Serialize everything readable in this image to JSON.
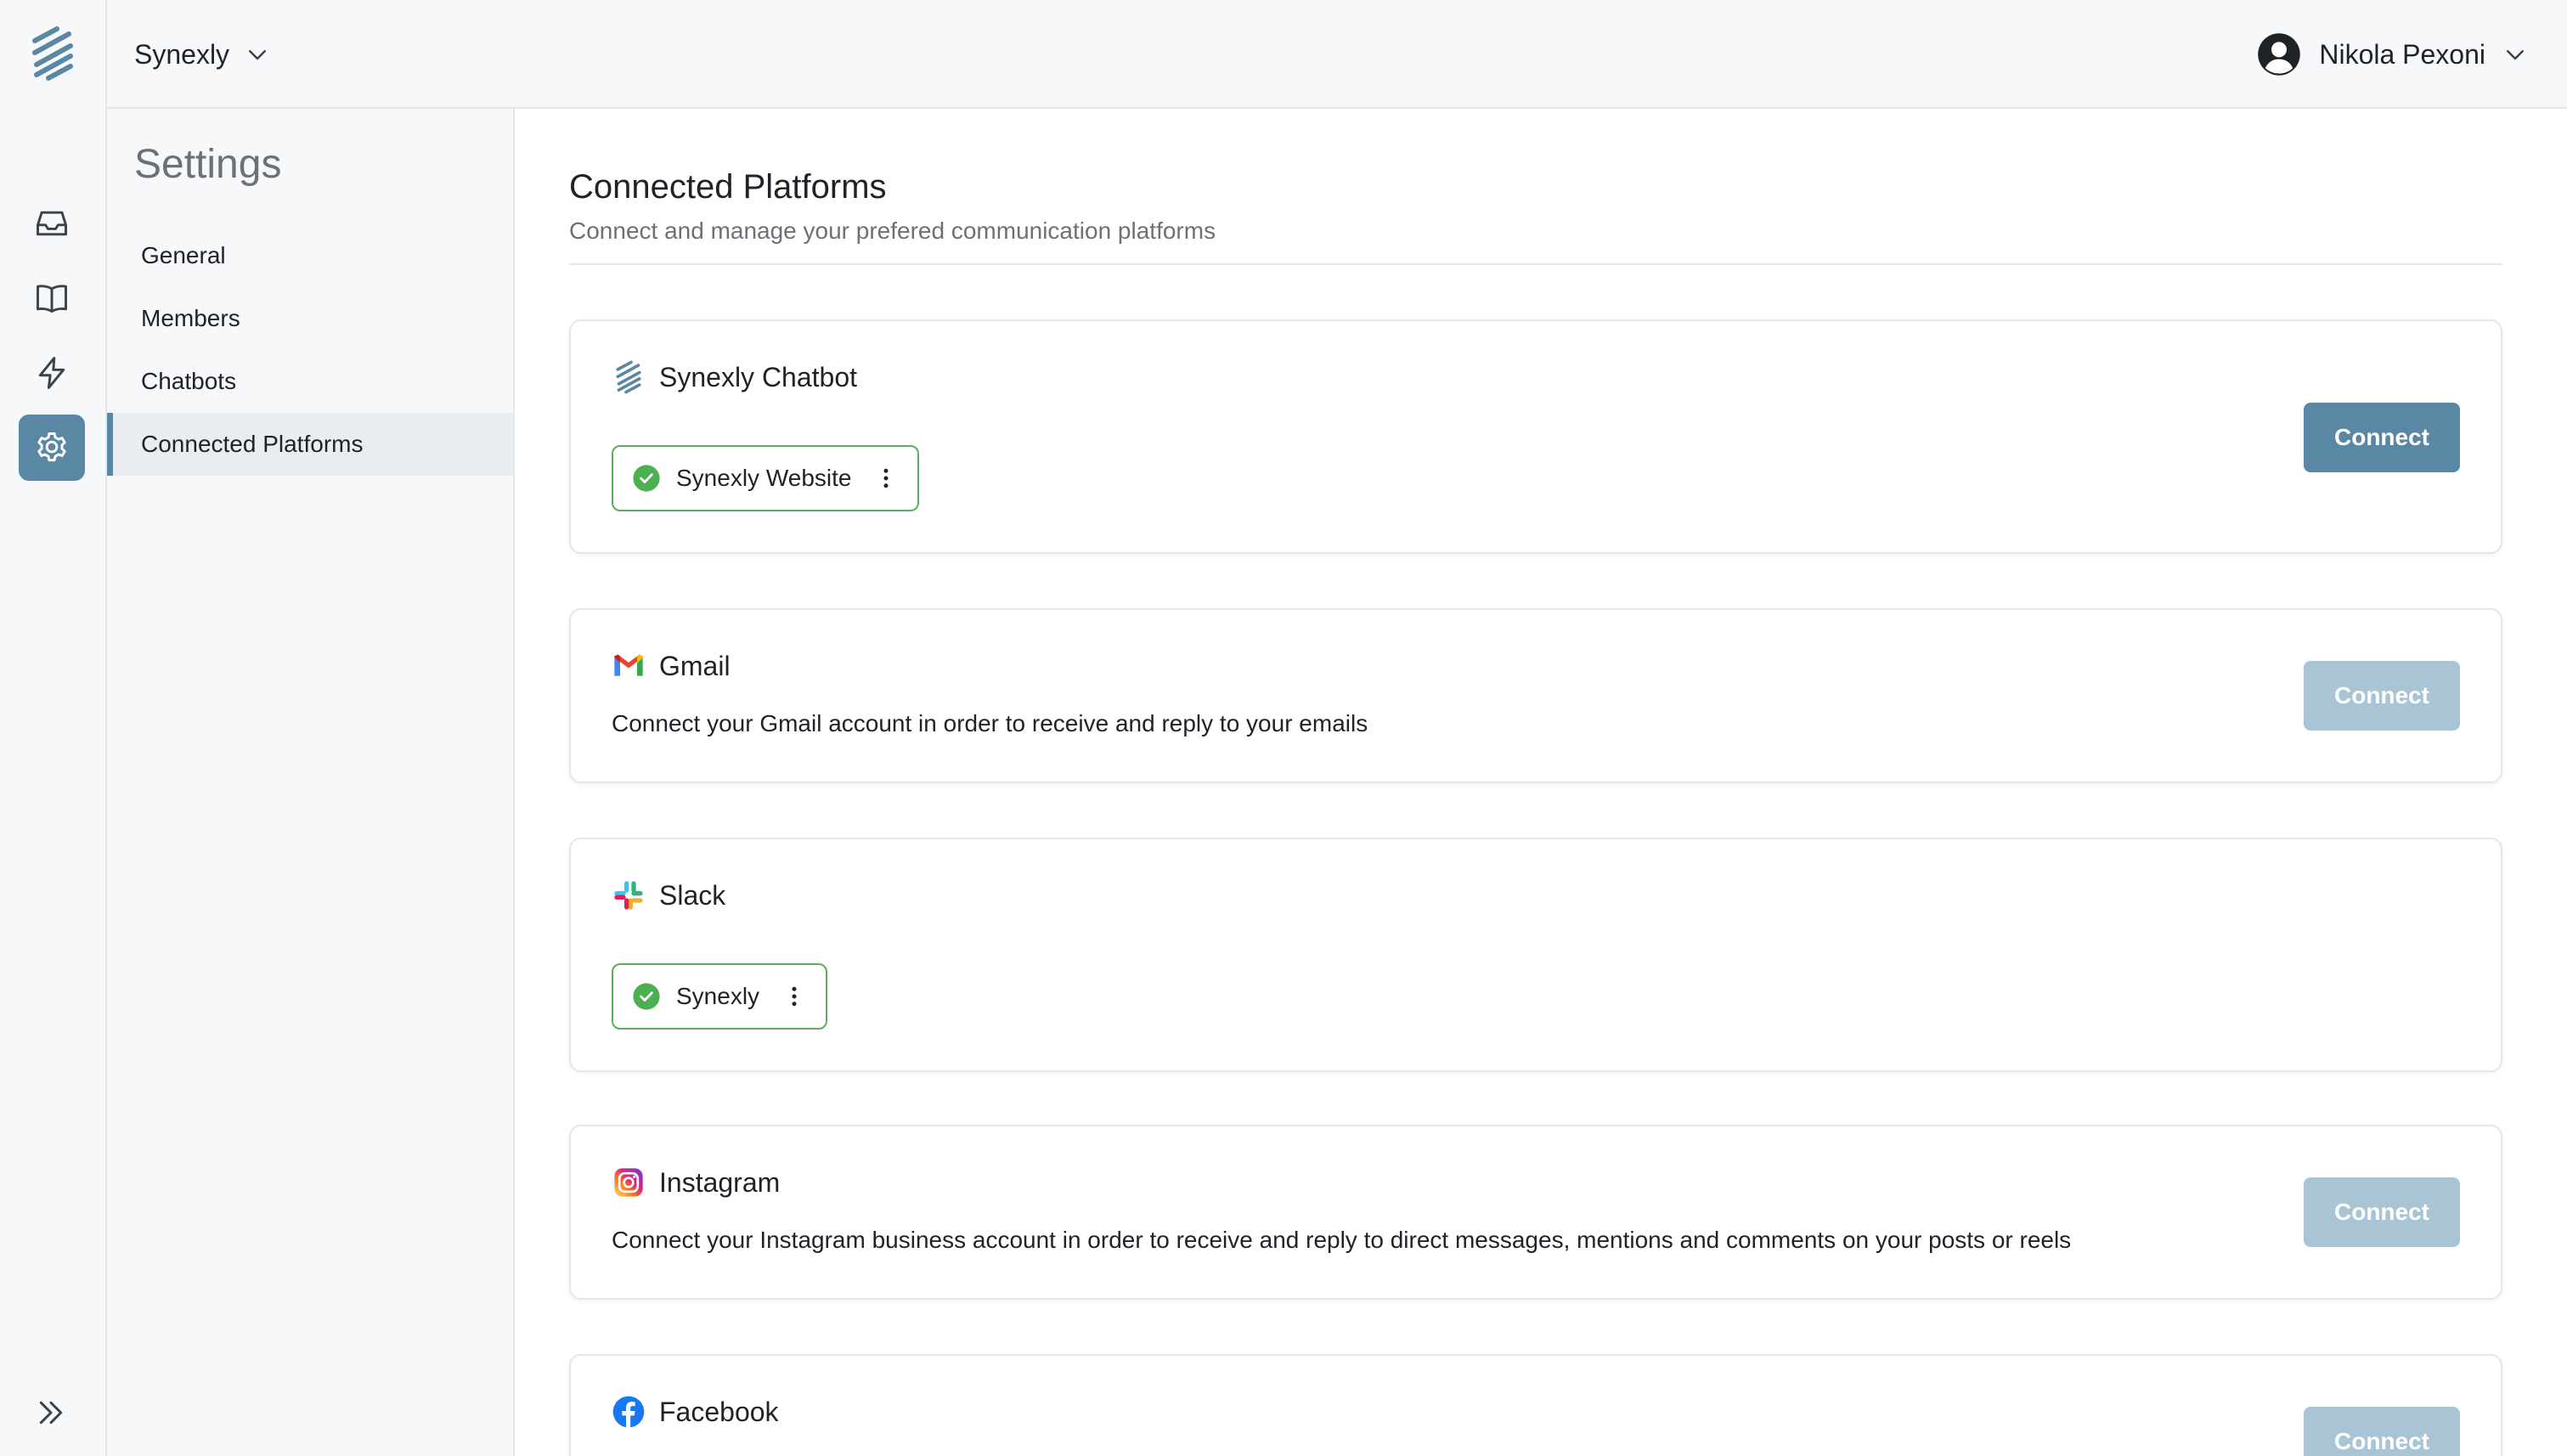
{
  "header": {
    "workspace_name": "Synexly",
    "user_name": "Nikola Pexoni"
  },
  "rail": {
    "items": [
      {
        "icon": "inbox-icon"
      },
      {
        "icon": "book-icon"
      },
      {
        "icon": "lightning-icon"
      },
      {
        "icon": "gear-icon",
        "active": true
      }
    ],
    "expand_icon": "double-chevron-right-icon"
  },
  "settings": {
    "title": "Settings",
    "items": [
      {
        "label": "General"
      },
      {
        "label": "Members"
      },
      {
        "label": "Chatbots"
      },
      {
        "label": "Connected Platforms",
        "active": true
      }
    ]
  },
  "page": {
    "title": "Connected Platforms",
    "subtitle": "Connect and manage your prefered communication platforms"
  },
  "platforms": [
    {
      "name": "Synexly Chatbot",
      "icon": "synexly-icon",
      "connection": "Synexly Website",
      "button": "Connect",
      "button_enabled": true
    },
    {
      "name": "Gmail",
      "icon": "gmail-icon",
      "description": "Connect your Gmail account in order to receive and reply to your emails",
      "button": "Connect",
      "button_enabled": false
    },
    {
      "name": "Slack",
      "icon": "slack-icon",
      "connection": "Synexly"
    },
    {
      "name": "Instagram",
      "icon": "instagram-icon",
      "description": "Connect your Instagram business account in order to receive and reply to direct messages, mentions and comments on your posts or reels",
      "button": "Connect",
      "button_enabled": false
    },
    {
      "name": "Facebook",
      "icon": "facebook-icon",
      "button": "Connect",
      "button_enabled": false
    }
  ],
  "colors": {
    "accent": "#5a87a3",
    "accent_disabled": "#a9c4d4",
    "success": "#5cae5c",
    "sidebar_bg": "#f7f8f9"
  }
}
